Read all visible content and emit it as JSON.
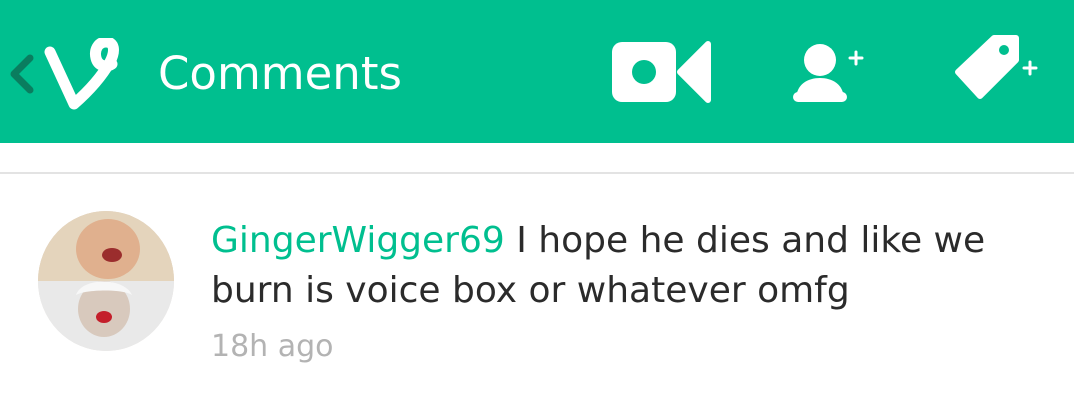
{
  "header": {
    "title": "Comments",
    "background_color": "#00bf8f",
    "icons": [
      "back-chevron-icon",
      "vine-logo-icon",
      "video-camera-icon",
      "add-user-icon",
      "add-tag-icon"
    ]
  },
  "comments": [
    {
      "username": "GingerWigger69",
      "text": "I hope he dies and like we burn is voice box or whatever omfg",
      "timestamp": "18h ago"
    }
  ],
  "colors": {
    "accent": "#00bf8f",
    "text": "#2b2b2b",
    "muted": "#b3b3b3",
    "divider": "#e3e3e3"
  }
}
